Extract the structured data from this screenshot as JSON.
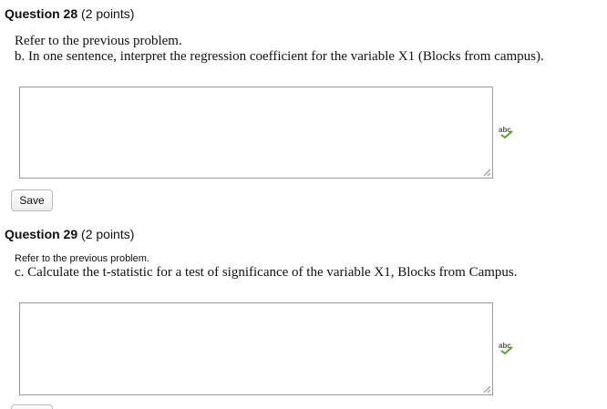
{
  "questions": [
    {
      "number_label": "Question 28",
      "points_label": "(2 points)",
      "prompt_line1": "Refer to the previous problem.",
      "prompt_line2": "b. In one sentence, interpret the regression coefficient for the variable X1 (Blocks from campus).",
      "answer_value": "",
      "spellcheck_icon": "spellcheck-abc-icon",
      "save_label": "Save"
    },
    {
      "number_label": "Question 29",
      "points_label": "(2 points)",
      "prompt_line1": "Refer to the previous problem.",
      "prompt_line2": "c. Calculate the t-statistic for a test of significance of the variable X1, Blocks from Campus.",
      "answer_value": "",
      "spellcheck_icon": "spellcheck-abc-icon",
      "save_label": ""
    }
  ],
  "colors": {
    "box_border": "#9a9a9a",
    "spellcheck_text": "#555555",
    "spellcheck_check": "#5aa02c"
  }
}
